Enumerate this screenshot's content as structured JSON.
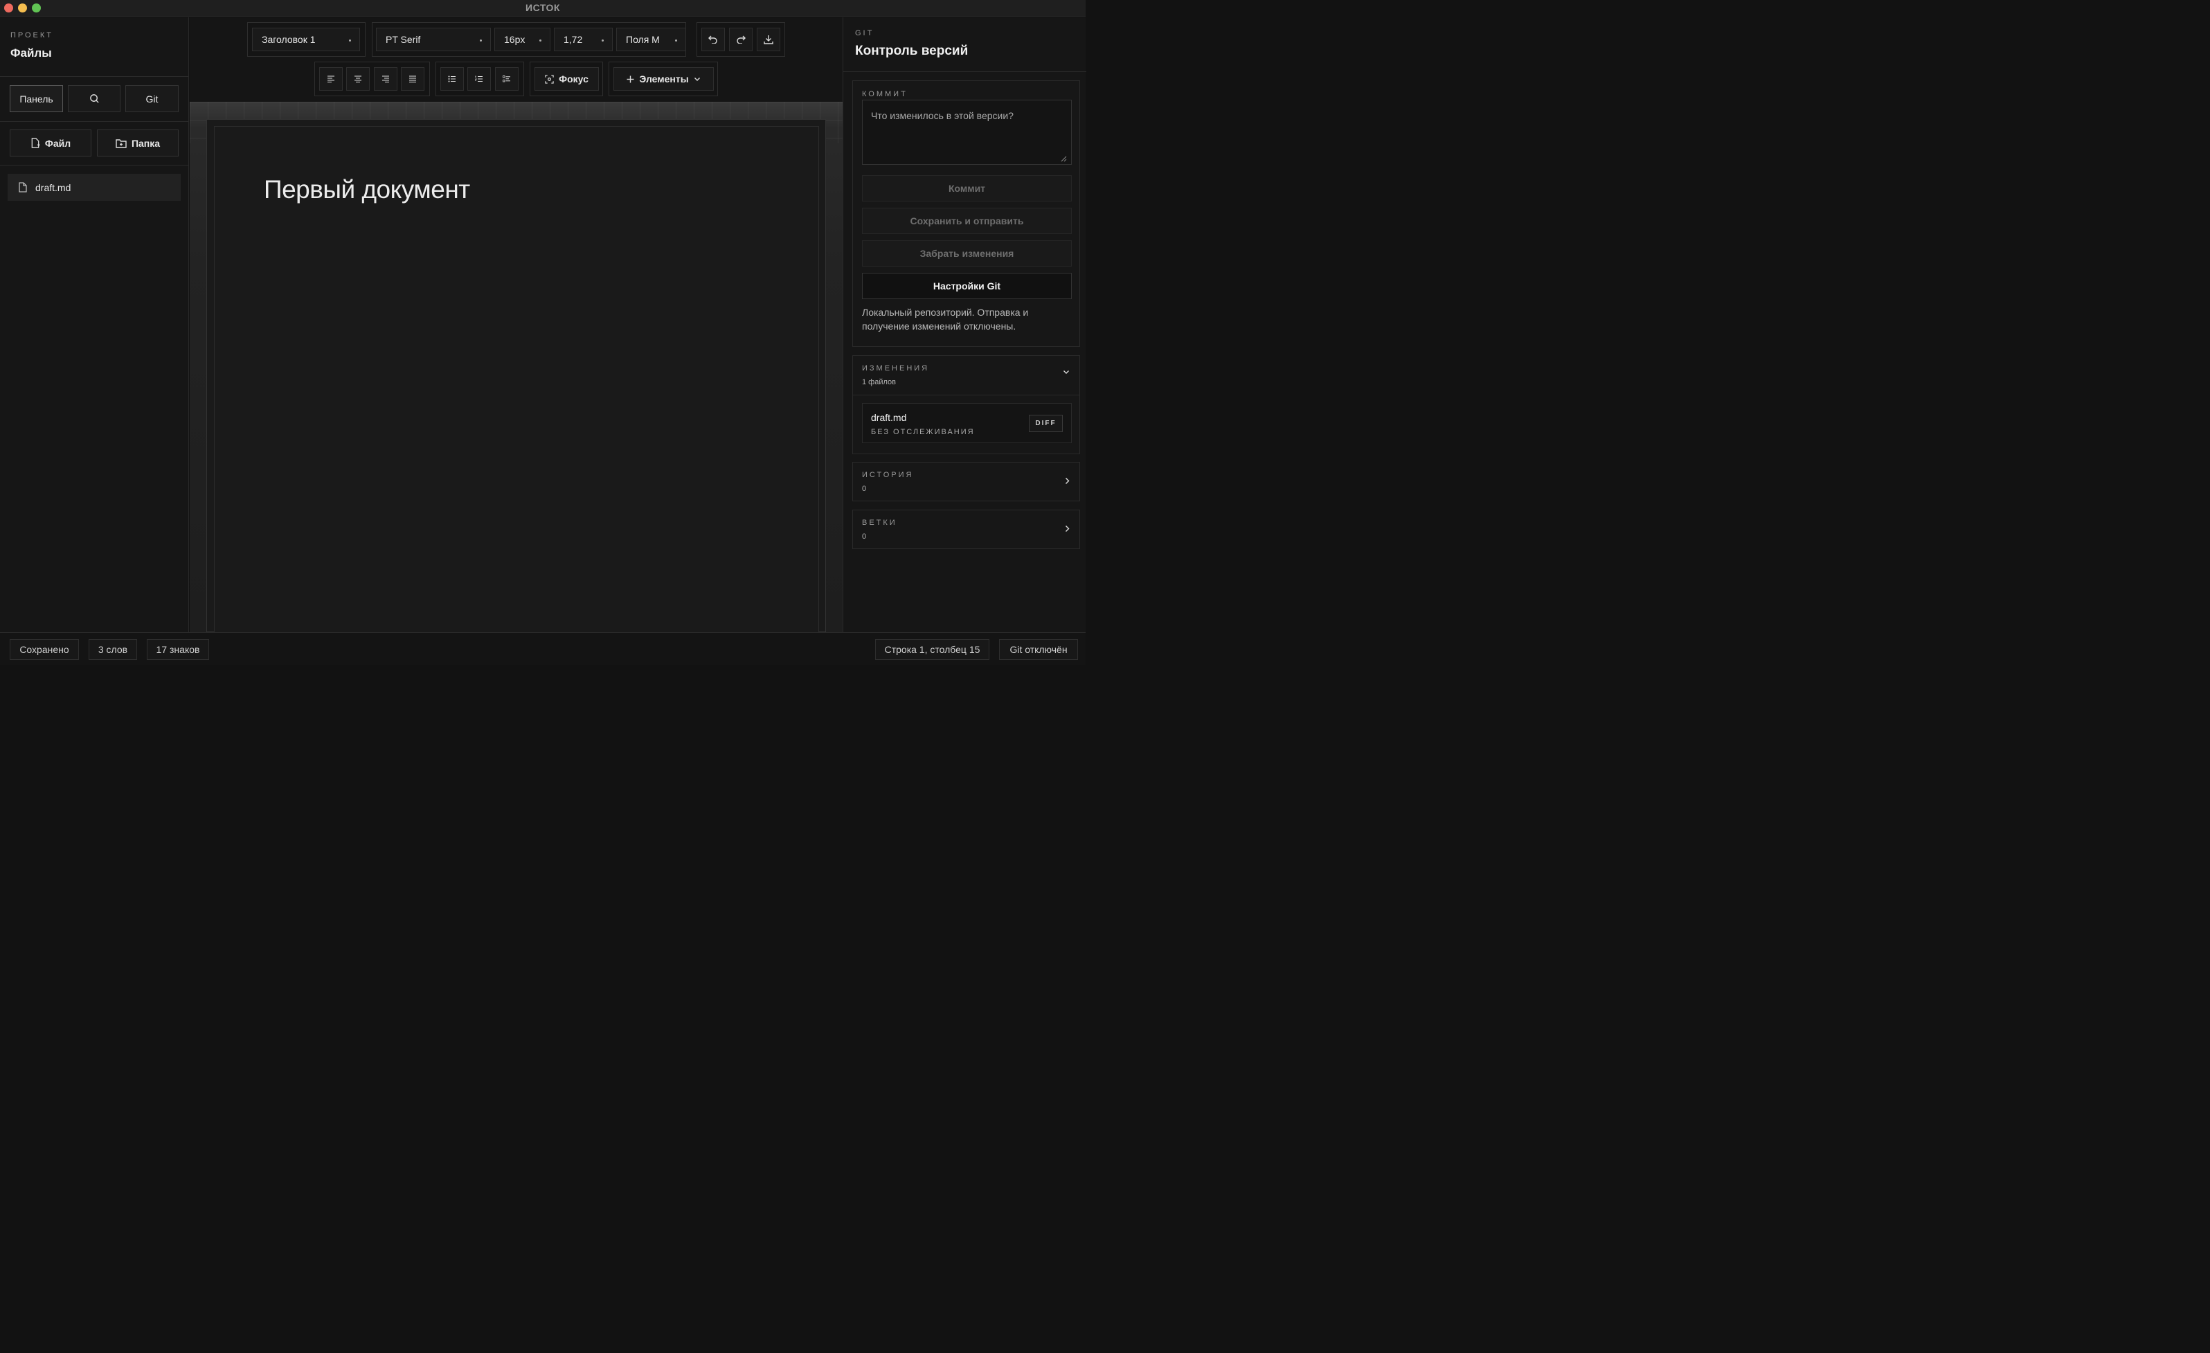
{
  "window": {
    "title": "ИСТОК"
  },
  "sidebar": {
    "eyebrow": "ПРОЕКТ",
    "heading": "Файлы",
    "buttons": {
      "panel": "Панель",
      "git": "Git",
      "new_file": "Файл",
      "new_folder": "Папка"
    },
    "files": [
      {
        "name": "draft.md"
      }
    ]
  },
  "toolbar": {
    "block_style": "Заголовок 1",
    "font": "PT Serif",
    "font_size": "16px",
    "line_height": "1,72",
    "margins": "Поля M",
    "focus_label": "Фокус",
    "elements_label": "Элементы"
  },
  "document": {
    "title": "Первый документ"
  },
  "git_panel": {
    "eyebrow": "GIT",
    "heading": "Контроль версий",
    "commit": {
      "eyebrow": "КОММИТ",
      "placeholder": "Что изменилось в этой версии?",
      "commit_button": "Коммит",
      "push_button": "Сохранить и отправить",
      "pull_button": "Забрать изменения",
      "settings_button": "Настройки Git",
      "note": "Локальный репозиторий. Отправка и получение изменений отключены."
    },
    "changes": {
      "eyebrow": "ИЗМЕНЕНИЯ",
      "count": "1 файлов",
      "items": [
        {
          "name": "draft.md",
          "status": "БЕЗ ОТСЛЕЖИВАНИЯ",
          "diff_label": "DIFF"
        }
      ]
    },
    "history": {
      "eyebrow": "ИСТОРИЯ",
      "count": "0"
    },
    "branches": {
      "eyebrow": "ВЕТКИ",
      "count": "0"
    }
  },
  "statusbar": {
    "saved": "Сохранено",
    "words": "3 слов",
    "chars": "17 знаков",
    "cursor": "Строка 1, столбец 15",
    "git_status": "Git отключён"
  },
  "colors": {
    "background": "#121212",
    "panel": "#161616",
    "text": "#e6e6e6",
    "muted": "#6e6e6e"
  }
}
